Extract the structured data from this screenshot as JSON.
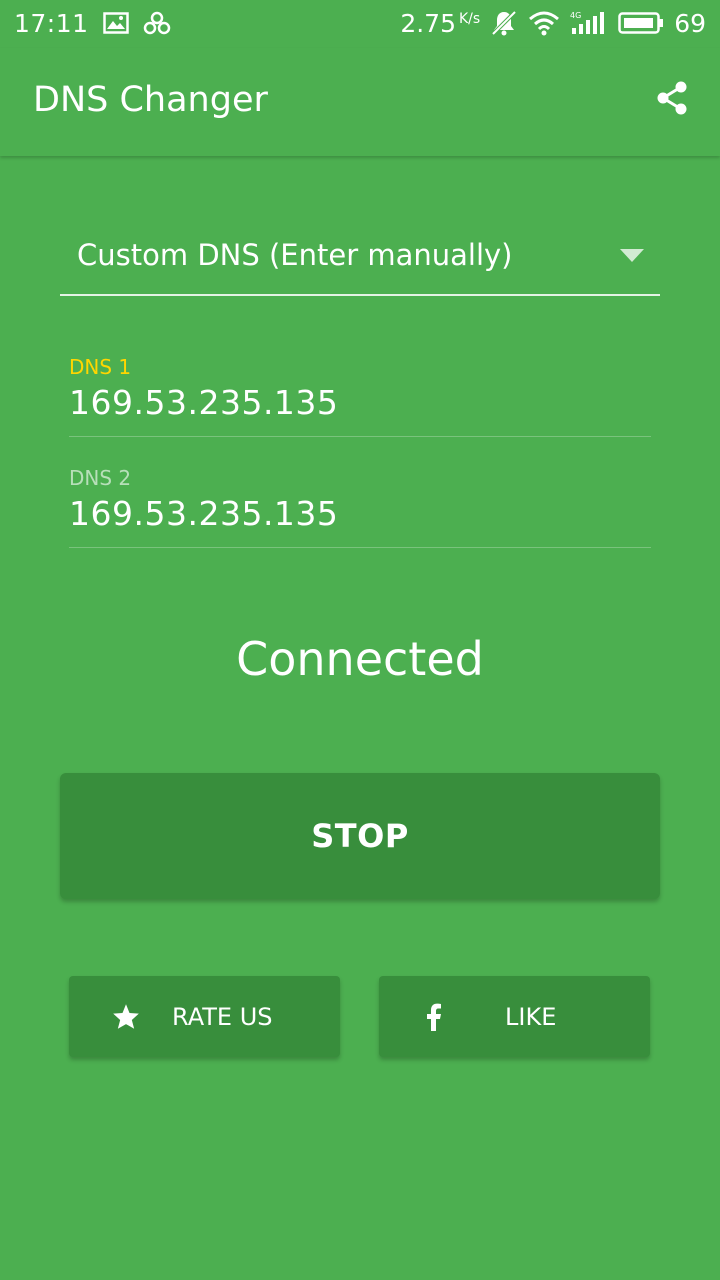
{
  "status_bar": {
    "time": "17:11",
    "speed_value": "2.75",
    "speed_unit": "K/s",
    "battery": "69"
  },
  "app_bar": {
    "title": "DNS Changer"
  },
  "dns_selector": {
    "selected": "Custom DNS (Enter manually)"
  },
  "fields": {
    "dns1_label": "DNS 1",
    "dns1_value": "169.53.235.135",
    "dns2_label": "DNS 2",
    "dns2_value": "169.53.235.135"
  },
  "connection": {
    "status": "Connected"
  },
  "buttons": {
    "stop_label": "STOP",
    "rate_label": "RATE US",
    "like_label": "LIKE"
  },
  "colors": {
    "background": "#4caf50",
    "button": "#388e3c",
    "active_label": "#ffd600"
  }
}
